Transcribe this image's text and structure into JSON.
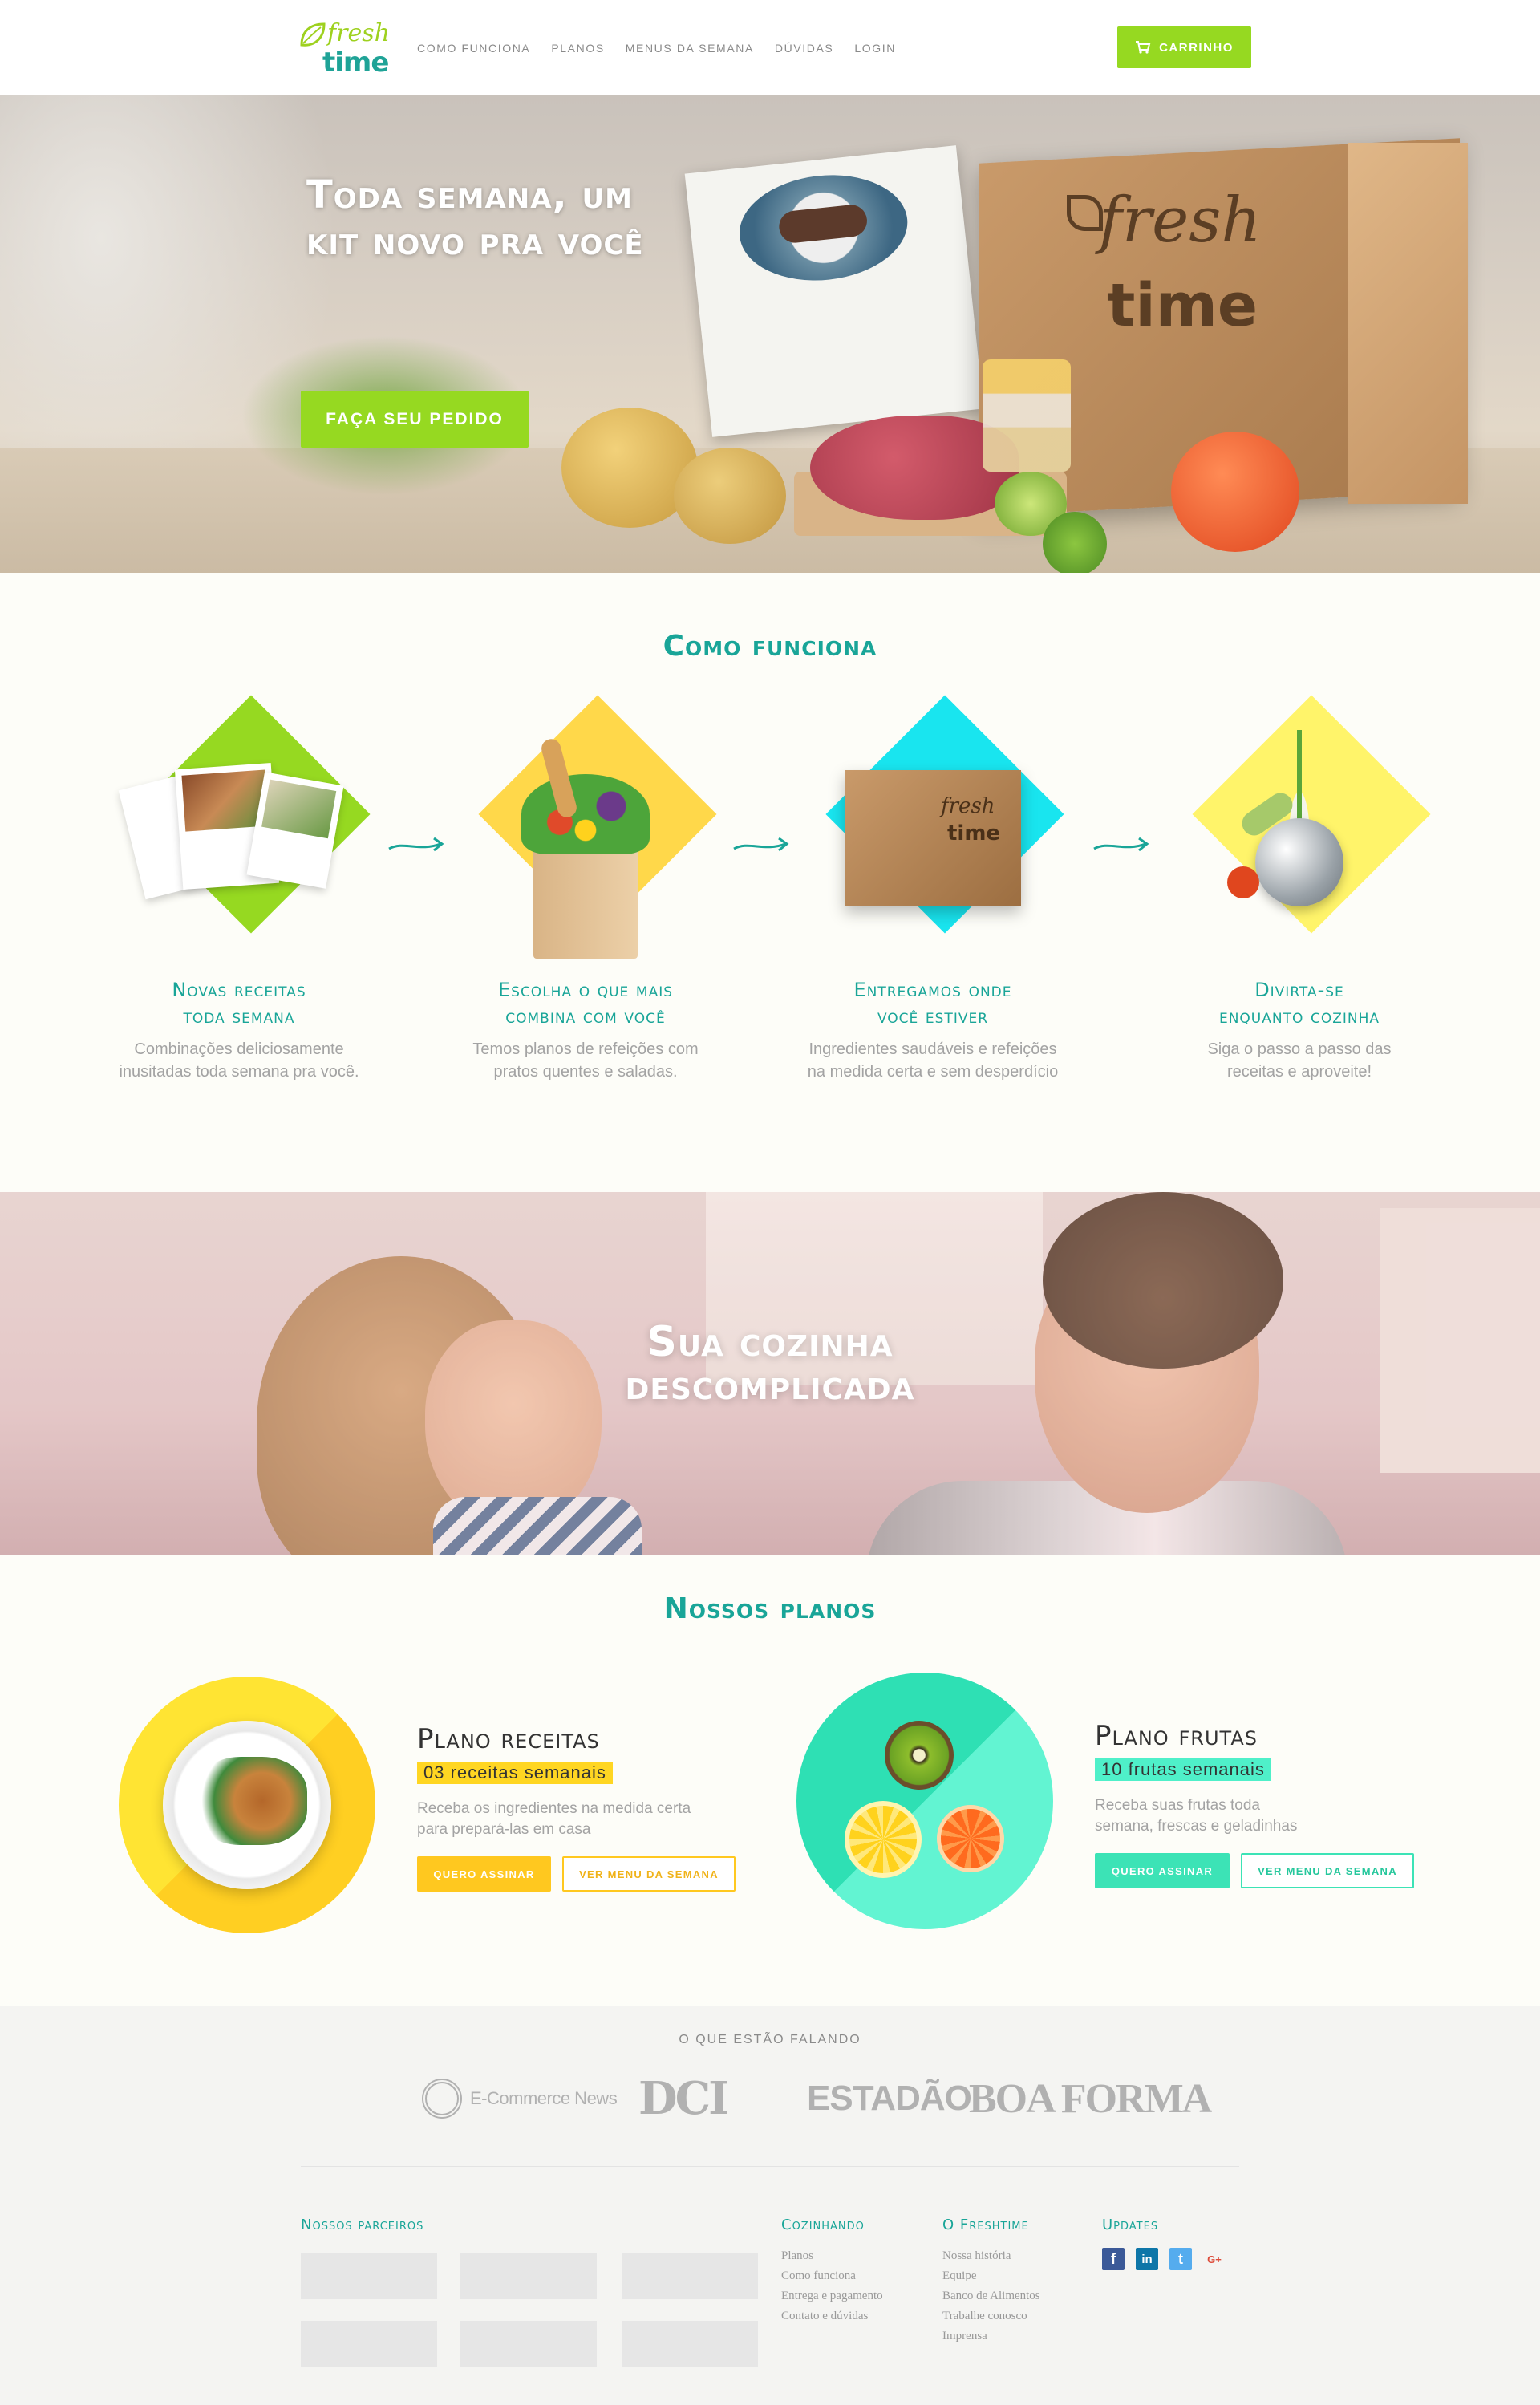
{
  "brand": {
    "word1": "fresh",
    "word2": "time",
    "green": "#96d921",
    "teal": "#19a598"
  },
  "nav": {
    "items": [
      "Como Funciona",
      "Planos",
      "Menus da Semana",
      "Dúvidas",
      "Login"
    ],
    "cart_label": "CARRINHO",
    "cart_icon": "cart-icon"
  },
  "hero": {
    "title_line1": "Toda semana, um",
    "title_line2": "kit novo pra você",
    "cta": "FAÇA SEU PEDIDO"
  },
  "how": {
    "title": "Como funciona",
    "steps": [
      {
        "title_line1": "Novas receitas",
        "title_line2": "toda semana",
        "text_line1": "Combinações deliciosamente",
        "text_line2": "inusitadas toda semana pra você.",
        "color": "#96d921"
      },
      {
        "title_line1": "Escolha o que mais",
        "title_line2": "combina com você",
        "text_line1": "Temos planos de refeições com",
        "text_line2": "pratos quentes e saladas.",
        "color": "#ffd84a"
      },
      {
        "title_line1": "Entregamos onde",
        "title_line2": "você estiver",
        "text_line1": "Ingredientes saudáveis e refeições",
        "text_line2": "na medida certa e sem desperdício",
        "color": "#19e5ef"
      },
      {
        "title_line1": "Divirta-se",
        "title_line2": "enquanto cozinha",
        "text_line1": "Siga o passo a passo das",
        "text_line2": "receitas e aproveite!",
        "color": "#fff46a"
      }
    ]
  },
  "banner": {
    "line1": "Sua cozinha",
    "line2": "descomplicada"
  },
  "plans": {
    "title": "Nossos planos",
    "items": [
      {
        "name": "Plano receitas",
        "tag": "03 receitas semanais",
        "text_line1": "Receba os ingredientes na medida certa",
        "text_line2": "para prepará-las em casa",
        "btn_primary": "QUERO ASSINAR",
        "btn_secondary": "VER MENU DA SEMANA"
      },
      {
        "name": "Plano frutas",
        "tag": "10 frutas semanais",
        "text_line1": "Receba suas frutas toda",
        "text_line2": "semana, frescas e geladinhas",
        "btn_primary": "QUERO ASSINAR",
        "btn_secondary": "VER MENU DA SEMANA"
      }
    ]
  },
  "press": {
    "title": "O QUE ESTÃO FALANDO",
    "logos": [
      "E-Commerce News",
      "DCI",
      "ESTADÃO",
      "BOA FORMA"
    ]
  },
  "footer": {
    "partners_title": "Nossos parceiros",
    "columns": [
      {
        "title": "Cozinhando",
        "links": [
          "Planos",
          "Como funciona",
          "Entrega e pagamento",
          "Contato e dúvidas"
        ]
      },
      {
        "title": "O Freshtime",
        "links": [
          "Nossa história",
          "Equipe",
          "Banco de Alimentos",
          "Trabalhe conosco",
          "Imprensa"
        ]
      },
      {
        "title": "Updates",
        "links": []
      }
    ],
    "social": [
      {
        "icon": "facebook-icon",
        "glyph": "f",
        "color": "#3b5998"
      },
      {
        "icon": "linkedin-icon",
        "glyph": "in",
        "color": "#0e76a8"
      },
      {
        "icon": "twitter-icon",
        "glyph": "t",
        "color": "#55acee"
      },
      {
        "icon": "google-plus-icon",
        "glyph": "G+",
        "color": "#dd4b39"
      }
    ]
  }
}
